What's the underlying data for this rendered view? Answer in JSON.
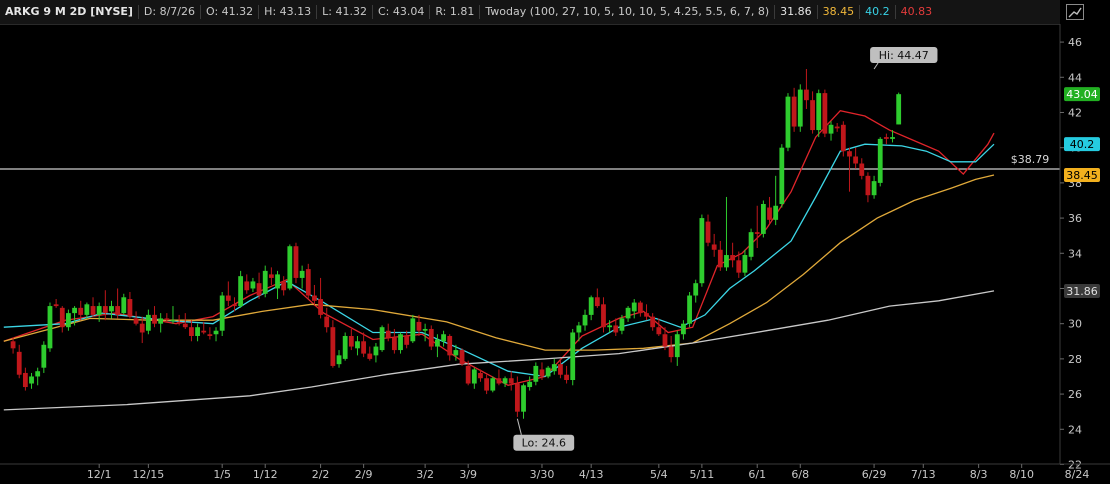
{
  "header": {
    "symbol": "ARKG 9 M 2D [NYSE]",
    "date": "D: 8/7/26",
    "open": "O: 41.32",
    "high": "H: 43.13",
    "low": "L: 41.32",
    "close": "C: 43.04",
    "range": "R: 1.81",
    "study": "Twoday (100, 27, 10, 5, 10, 10, 5, 4.25, 5.5, 6, 7, 8)",
    "study_v1": "31.86",
    "study_v2": "38.45",
    "study_v3": "40.2",
    "study_v4": "40.83"
  },
  "icons": {
    "settings": "chart-settings-icon"
  },
  "colors": {
    "background": "#000000",
    "up": "#2ecc2e",
    "down": "#c0171b",
    "ma_red": "#e0242a",
    "ma_cyan": "#3cd6e6",
    "ma_orange": "#e0a93a",
    "ma_gray": "#c9c9c9",
    "axis_text": "#c8c8c8",
    "hline": "#ffffff"
  },
  "chart_data": {
    "type": "candlestick",
    "y_ticks": [
      22,
      24,
      26,
      28,
      30,
      32,
      34,
      36,
      38,
      40,
      42,
      44,
      46
    ],
    "y_range": [
      22,
      46.8
    ],
    "x_ticks": [
      {
        "label": "12/1",
        "i": 15
      },
      {
        "label": "12/15",
        "i": 23
      },
      {
        "label": "1/5",
        "i": 35
      },
      {
        "label": "1/12",
        "i": 42
      },
      {
        "label": "2/2",
        "i": 51
      },
      {
        "label": "2/9",
        "i": 58
      },
      {
        "label": "3/2",
        "i": 68
      },
      {
        "label": "3/9",
        "i": 75
      },
      {
        "label": "3/30",
        "i": 87
      },
      {
        "label": "4/13",
        "i": 95
      },
      {
        "label": "5/4",
        "i": 106
      },
      {
        "label": "5/11",
        "i": 113
      },
      {
        "label": "6/1",
        "i": 122
      },
      {
        "label": "6/8",
        "i": 129
      },
      {
        "label": "6/29",
        "i": 141
      },
      {
        "label": "7/13",
        "i": 149
      },
      {
        "label": "8/3",
        "i": 158
      },
      {
        "label": "8/10",
        "i": 165
      },
      {
        "label": "8/24",
        "i": 174
      }
    ],
    "candles": [
      [
        29.0,
        29.2,
        28.3,
        28.6
      ],
      [
        28.4,
        28.8,
        26.9,
        27.1
      ],
      [
        27.2,
        27.5,
        26.2,
        26.4
      ],
      [
        26.6,
        27.2,
        26.3,
        27.0
      ],
      [
        27.0,
        27.5,
        26.5,
        27.3
      ],
      [
        27.5,
        29.0,
        27.2,
        28.8
      ],
      [
        28.6,
        31.2,
        28.4,
        31.0
      ],
      [
        31.1,
        31.4,
        30.9,
        31.0
      ],
      [
        30.9,
        31.0,
        29.5,
        29.8
      ],
      [
        29.8,
        30.8,
        29.6,
        30.6
      ],
      [
        30.6,
        31.0,
        29.9,
        30.9
      ],
      [
        30.9,
        31.3,
        30.2,
        30.5
      ],
      [
        30.5,
        31.2,
        30.3,
        31.1
      ],
      [
        31.0,
        31.5,
        30.4,
        30.5
      ],
      [
        30.5,
        31.2,
        30.1,
        31.0
      ],
      [
        31.0,
        31.9,
        30.2,
        30.6
      ],
      [
        30.7,
        31.3,
        30.3,
        31.0
      ],
      [
        31.0,
        32.0,
        30.3,
        30.5
      ],
      [
        30.6,
        31.7,
        30.5,
        31.5
      ],
      [
        31.4,
        31.8,
        30.3,
        30.4
      ],
      [
        30.3,
        30.7,
        29.9,
        30.0
      ],
      [
        30.0,
        30.4,
        28.9,
        29.5
      ],
      [
        29.6,
        30.8,
        29.4,
        30.5
      ],
      [
        30.5,
        31.0,
        29.8,
        30.0
      ],
      [
        30.0,
        30.6,
        29.5,
        30.3
      ],
      [
        30.3,
        30.6,
        30.1,
        30.2
      ],
      [
        30.2,
        31.0,
        30.0,
        30.2
      ],
      [
        30.1,
        30.5,
        29.9,
        30.0
      ],
      [
        30.0,
        30.6,
        29.7,
        29.8
      ],
      [
        29.8,
        30.2,
        29.0,
        29.3
      ],
      [
        29.3,
        30.0,
        29.0,
        29.8
      ],
      [
        29.6,
        30.1,
        29.4,
        29.5
      ],
      [
        29.4,
        29.8,
        29.1,
        29.3
      ],
      [
        29.4,
        29.8,
        29.0,
        29.6
      ],
      [
        29.6,
        31.8,
        29.3,
        31.6
      ],
      [
        31.6,
        32.4,
        31.0,
        31.3
      ],
      [
        31.1,
        31.5,
        30.7,
        31.0
      ],
      [
        31.0,
        33.0,
        30.9,
        32.7
      ],
      [
        32.4,
        32.8,
        31.7,
        31.9
      ],
      [
        32.0,
        32.6,
        31.8,
        32.4
      ],
      [
        32.3,
        32.9,
        31.4,
        31.6
      ],
      [
        31.7,
        33.3,
        31.5,
        33.0
      ],
      [
        32.8,
        33.2,
        32.2,
        32.6
      ],
      [
        32.0,
        33.0,
        31.4,
        32.8
      ],
      [
        32.4,
        32.7,
        31.6,
        31.9
      ],
      [
        32.0,
        34.5,
        31.9,
        34.4
      ],
      [
        34.4,
        34.6,
        32.3,
        32.6
      ],
      [
        32.6,
        33.3,
        32.0,
        33.0
      ],
      [
        33.1,
        33.4,
        31.4,
        31.6
      ],
      [
        31.6,
        32.2,
        31.0,
        31.3
      ],
      [
        31.4,
        32.6,
        30.3,
        30.5
      ],
      [
        30.4,
        30.9,
        29.5,
        29.8
      ],
      [
        29.8,
        30.2,
        27.5,
        27.6
      ],
      [
        27.7,
        28.5,
        27.5,
        28.2
      ],
      [
        28.0,
        29.5,
        27.9,
        29.3
      ],
      [
        29.3,
        29.7,
        28.5,
        28.7
      ],
      [
        28.6,
        29.3,
        28.2,
        29.0
      ],
      [
        29.0,
        29.5,
        28.1,
        28.3
      ],
      [
        28.3,
        28.7,
        27.9,
        28.0
      ],
      [
        28.2,
        28.9,
        27.8,
        28.7
      ],
      [
        28.5,
        29.9,
        28.4,
        29.8
      ],
      [
        29.6,
        30.0,
        29.0,
        29.2
      ],
      [
        29.2,
        29.7,
        28.3,
        28.5
      ],
      [
        28.5,
        29.5,
        28.3,
        29.4
      ],
      [
        29.3,
        29.6,
        28.6,
        28.8
      ],
      [
        29.0,
        30.5,
        28.9,
        30.3
      ],
      [
        30.1,
        30.5,
        29.3,
        29.6
      ],
      [
        29.6,
        30.0,
        29.0,
        29.7
      ],
      [
        29.7,
        29.9,
        28.5,
        28.7
      ],
      [
        28.7,
        29.4,
        28.1,
        29.1
      ],
      [
        29.0,
        29.6,
        28.7,
        29.4
      ],
      [
        29.3,
        29.4,
        27.9,
        28.2
      ],
      [
        28.2,
        28.8,
        27.9,
        28.5
      ],
      [
        28.5,
        28.6,
        27.6,
        27.7
      ],
      [
        27.6,
        27.9,
        26.5,
        26.6
      ],
      [
        26.6,
        27.5,
        26.3,
        27.4
      ],
      [
        27.2,
        27.4,
        26.7,
        26.9
      ],
      [
        26.9,
        27.1,
        26.0,
        26.2
      ],
      [
        26.2,
        27.0,
        26.1,
        26.9
      ],
      [
        26.9,
        27.4,
        26.5,
        26.6
      ],
      [
        26.6,
        27.0,
        26.4,
        26.9
      ],
      [
        26.9,
        27.3,
        26.2,
        26.6
      ],
      [
        26.6,
        27.0,
        24.7,
        25.0
      ],
      [
        25.0,
        26.6,
        24.6,
        26.5
      ],
      [
        26.4,
        27.0,
        26.2,
        26.7
      ],
      [
        26.7,
        27.8,
        26.5,
        27.6
      ],
      [
        27.4,
        27.8,
        26.8,
        27.0
      ],
      [
        27.0,
        27.6,
        26.9,
        27.5
      ],
      [
        27.3,
        28.0,
        27.1,
        27.7
      ],
      [
        27.7,
        28.0,
        26.9,
        27.1
      ],
      [
        27.1,
        27.6,
        26.6,
        26.8
      ],
      [
        26.8,
        29.7,
        26.5,
        29.5
      ],
      [
        29.5,
        30.1,
        29.0,
        29.9
      ],
      [
        29.9,
        30.8,
        29.6,
        30.5
      ],
      [
        30.5,
        31.6,
        30.2,
        31.5
      ],
      [
        31.5,
        32.0,
        30.9,
        31.0
      ],
      [
        31.1,
        31.5,
        29.5,
        29.8
      ],
      [
        29.8,
        30.2,
        29.5,
        29.9
      ],
      [
        29.9,
        30.3,
        29.3,
        29.5
      ],
      [
        29.6,
        30.5,
        29.4,
        30.3
      ],
      [
        30.3,
        31.0,
        30.1,
        30.9
      ],
      [
        30.7,
        31.4,
        30.3,
        31.2
      ],
      [
        31.2,
        31.3,
        30.4,
        30.6
      ],
      [
        30.6,
        31.1,
        30.2,
        30.4
      ],
      [
        30.4,
        30.6,
        29.6,
        29.8
      ],
      [
        29.8,
        30.3,
        29.3,
        29.4
      ],
      [
        29.4,
        29.8,
        28.5,
        28.7
      ],
      [
        28.7,
        29.3,
        27.8,
        28.1
      ],
      [
        28.1,
        29.6,
        27.6,
        29.4
      ],
      [
        29.4,
        30.2,
        29.1,
        30.0
      ],
      [
        30.0,
        31.8,
        29.8,
        31.6
      ],
      [
        31.6,
        32.5,
        31.2,
        32.3
      ],
      [
        32.3,
        36.2,
        32.1,
        36.0
      ],
      [
        35.8,
        36.2,
        34.4,
        34.6
      ],
      [
        34.5,
        35.1,
        33.8,
        34.2
      ],
      [
        34.2,
        34.7,
        33.0,
        33.2
      ],
      [
        33.2,
        37.2,
        33.0,
        33.9
      ],
      [
        33.9,
        34.6,
        33.2,
        33.6
      ],
      [
        33.6,
        34.1,
        32.6,
        32.9
      ],
      [
        32.9,
        34.2,
        32.7,
        33.9
      ],
      [
        33.8,
        35.4,
        33.6,
        35.2
      ],
      [
        35.2,
        36.7,
        34.3,
        35.1
      ],
      [
        35.1,
        37.0,
        34.9,
        36.8
      ],
      [
        36.6,
        37.2,
        35.7,
        35.9
      ],
      [
        35.9,
        38.4,
        35.6,
        36.7
      ],
      [
        36.8,
        40.2,
        36.6,
        40.0
      ],
      [
        40.0,
        43.1,
        39.8,
        42.9
      ],
      [
        42.9,
        43.4,
        40.9,
        41.2
      ],
      [
        41.2,
        43.6,
        40.9,
        43.3
      ],
      [
        43.3,
        44.47,
        42.2,
        42.7
      ],
      [
        42.7,
        43.2,
        40.8,
        41.0
      ],
      [
        41.0,
        43.3,
        40.6,
        43.1
      ],
      [
        43.1,
        43.3,
        40.6,
        40.8
      ],
      [
        40.8,
        41.5,
        40.4,
        41.3
      ],
      [
        41.2,
        41.4,
        40.9,
        41.1
      ],
      [
        41.3,
        41.5,
        39.5,
        39.8
      ],
      [
        39.8,
        40.0,
        37.5,
        39.5
      ],
      [
        39.5,
        40.0,
        38.8,
        39.1
      ],
      [
        39.1,
        39.4,
        38.2,
        38.4
      ],
      [
        38.4,
        38.6,
        36.9,
        37.3
      ],
      [
        37.3,
        38.4,
        37.1,
        38.1
      ],
      [
        38.0,
        40.6,
        37.8,
        40.5
      ],
      [
        40.6,
        40.8,
        40.2,
        40.5
      ],
      [
        40.5,
        41.0,
        40.3,
        40.6
      ],
      [
        41.32,
        43.13,
        41.32,
        43.04
      ]
    ],
    "plot_start": 1,
    "series": [
      {
        "name": "red",
        "values": [
          [
            0,
            29.0
          ],
          [
            10,
            30.2
          ],
          [
            18,
            30.6
          ],
          [
            28,
            30.0
          ],
          [
            34,
            30.4
          ],
          [
            40,
            31.6
          ],
          [
            46,
            32.5
          ],
          [
            52,
            30.6
          ],
          [
            60,
            29.1
          ],
          [
            68,
            29.4
          ],
          [
            74,
            28.0
          ],
          [
            82,
            26.5
          ],
          [
            88,
            27.0
          ],
          [
            94,
            29.3
          ],
          [
            100,
            30.3
          ],
          [
            104,
            30.7
          ],
          [
            108,
            29.5
          ],
          [
            112,
            29.8
          ],
          [
            116,
            33.3
          ],
          [
            120,
            34.0
          ],
          [
            124,
            35.4
          ],
          [
            128,
            37.5
          ],
          [
            132,
            40.6
          ],
          [
            136,
            42.1
          ],
          [
            140,
            41.8
          ],
          [
            144,
            41.0
          ],
          [
            148,
            40.4
          ],
          [
            152,
            39.8
          ],
          [
            156,
            38.5
          ],
          [
            160,
            40.2
          ],
          [
            161,
            40.83
          ]
        ]
      },
      {
        "name": "cyan",
        "values": [
          [
            0,
            29.8
          ],
          [
            10,
            30.0
          ],
          [
            16,
            30.6
          ],
          [
            26,
            30.2
          ],
          [
            34,
            30.0
          ],
          [
            40,
            31.3
          ],
          [
            46,
            32.4
          ],
          [
            52,
            31.2
          ],
          [
            60,
            29.5
          ],
          [
            68,
            29.5
          ],
          [
            74,
            28.6
          ],
          [
            82,
            27.3
          ],
          [
            88,
            27.0
          ],
          [
            94,
            28.6
          ],
          [
            100,
            29.8
          ],
          [
            106,
            30.3
          ],
          [
            110,
            29.8
          ],
          [
            114,
            30.5
          ],
          [
            118,
            32.0
          ],
          [
            122,
            33.0
          ],
          [
            128,
            34.7
          ],
          [
            132,
            37.2
          ],
          [
            136,
            39.8
          ],
          [
            140,
            40.2
          ],
          [
            146,
            40.1
          ],
          [
            150,
            39.8
          ],
          [
            154,
            39.2
          ],
          [
            158,
            39.2
          ],
          [
            161,
            40.2
          ]
        ]
      },
      {
        "name": "orange",
        "values": [
          [
            0,
            29.0
          ],
          [
            14,
            30.3
          ],
          [
            24,
            30.2
          ],
          [
            34,
            30.2
          ],
          [
            42,
            30.7
          ],
          [
            50,
            31.1
          ],
          [
            60,
            30.8
          ],
          [
            72,
            30.1
          ],
          [
            80,
            29.2
          ],
          [
            88,
            28.5
          ],
          [
            96,
            28.5
          ],
          [
            104,
            28.6
          ],
          [
            112,
            28.9
          ],
          [
            118,
            30.0
          ],
          [
            124,
            31.2
          ],
          [
            130,
            32.8
          ],
          [
            136,
            34.6
          ],
          [
            142,
            36.0
          ],
          [
            148,
            37.0
          ],
          [
            154,
            37.7
          ],
          [
            158,
            38.2
          ],
          [
            161,
            38.45
          ]
        ]
      },
      {
        "name": "gray",
        "values": [
          [
            0,
            25.1
          ],
          [
            20,
            25.4
          ],
          [
            40,
            25.9
          ],
          [
            50,
            26.4
          ],
          [
            62,
            27.1
          ],
          [
            74,
            27.7
          ],
          [
            88,
            28.0
          ],
          [
            100,
            28.3
          ],
          [
            112,
            28.9
          ],
          [
            124,
            29.6
          ],
          [
            134,
            30.2
          ],
          [
            144,
            31.0
          ],
          [
            152,
            31.3
          ],
          [
            161,
            31.86
          ]
        ]
      }
    ],
    "price_labels": [
      {
        "text": "43.04",
        "value": 43.04,
        "fill": "#22b022",
        "color": "#ffffff"
      },
      {
        "text": "40.2",
        "value": 40.2,
        "fill": "#25cbe0",
        "color": "#000000"
      },
      {
        "text": "38.45",
        "value": 38.45,
        "fill": "#f2b01e",
        "color": "#000000"
      },
      {
        "text": "31.86",
        "value": 31.86,
        "fill": "#3a3a3a",
        "color": "#e0e0e0"
      }
    ],
    "hline": {
      "value": 38.79,
      "label": "$38.79"
    },
    "hi_label": {
      "text": "Hi: 44.47",
      "value": 44.47,
      "i": 141
    },
    "lo_label": {
      "text": "Lo: 24.6",
      "value": 24.6,
      "i": 83
    }
  }
}
